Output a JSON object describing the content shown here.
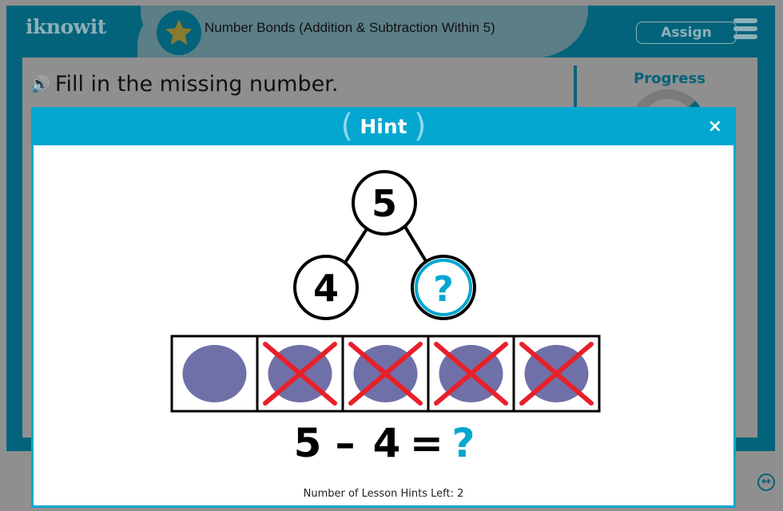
{
  "header": {
    "logo": "iknowit",
    "lesson_title": "Number Bonds (Addition & Subtraction Within 5)",
    "assign_label": "Assign"
  },
  "question": {
    "text": "Fill in the missing number."
  },
  "progress": {
    "title": "Progress"
  },
  "hint": {
    "title": "Hint",
    "close_label": "×",
    "number_bond": {
      "whole": "5",
      "part_known": "4",
      "part_unknown": "?"
    },
    "ten_frame": {
      "total": 5,
      "crossed_out": 4
    },
    "equation": {
      "a": "5",
      "op": "–",
      "b": "4",
      "eq": "=",
      "result": "?"
    },
    "hints_left_text": "Number of Lesson Hints Left: 2"
  },
  "colors": {
    "brand": "#03637b",
    "accent": "#03a7cf",
    "counter": "#7070a8",
    "cross": "#e8202a",
    "star": "#8a7a30"
  }
}
